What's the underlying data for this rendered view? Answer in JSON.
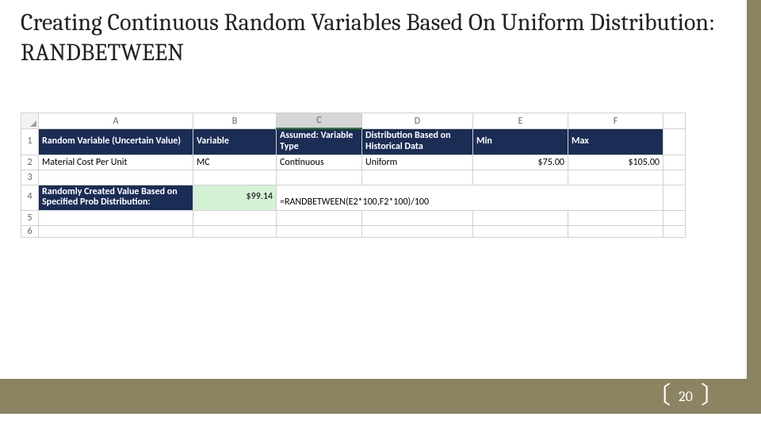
{
  "title": "Creating Continuous Random Variables Based On Uniform Distribution: RANDBETWEEN",
  "page_number": "20",
  "columns": {
    "a": "A",
    "b": "B",
    "c": "C",
    "d": "D",
    "e": "E",
    "f": "F"
  },
  "rows": {
    "r1": "1",
    "r2": "2",
    "r3": "3",
    "r4": "4",
    "r5": "5",
    "r6": "6"
  },
  "head": {
    "a": "Random Variable (Uncertain Value)",
    "b": "Variable",
    "c": "Assumed: Variable Type",
    "d": "Distribution Based on Historical Data",
    "e": "Min",
    "f": "Max"
  },
  "row2": {
    "a": "Material Cost Per Unit",
    "b": "MC",
    "c": "Continuous",
    "d": "Uniform",
    "e": "$75.00",
    "f": "$105.00"
  },
  "row4": {
    "a": "Randomly Created Value Based on Specified Prob Distribution:",
    "b": "$99.14",
    "c_formula": "=RANDBETWEEN(E2*100,F2*100)/100"
  }
}
